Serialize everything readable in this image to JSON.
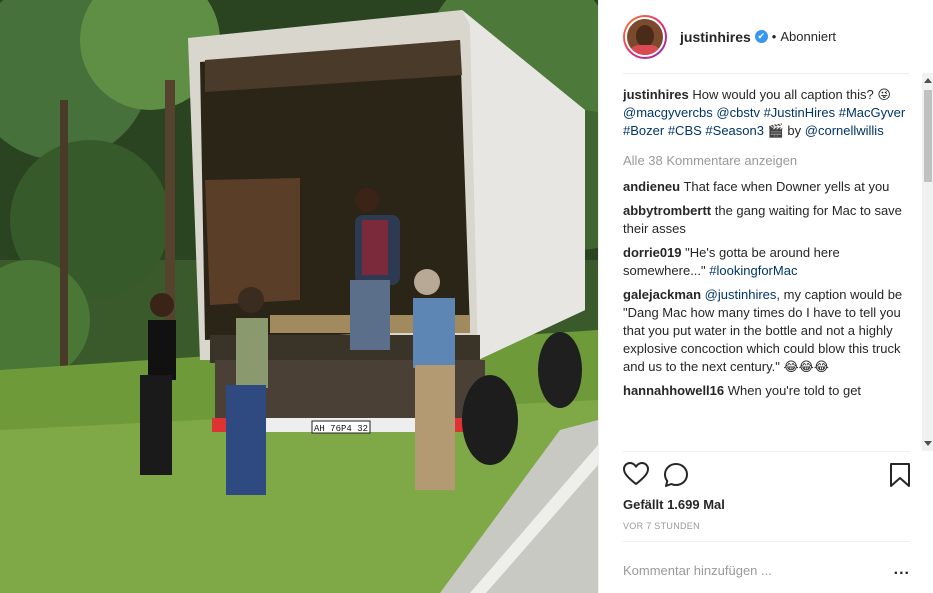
{
  "post": {
    "username": "justinhires",
    "verified_mark": "✔",
    "separator": "•",
    "follow_status": "Abonniert",
    "likes": "Gefällt 1.699 Mal",
    "timestamp": "VOR 7 STUNDEN",
    "add_comment_placeholder": "Kommentar hinzufügen ...",
    "more_options": "...",
    "license_plate": "AH 76P4 32"
  },
  "caption": {
    "user": "justinhires",
    "text_1": "How would you all caption this? 😜",
    "tag_1": "@macgyvercbs",
    "tag_2": "@cbstv",
    "tag_3": "#JustinHires",
    "tag_4": "#MacGyver",
    "tag_5": "#Bozer",
    "tag_6": "#CBS",
    "tag_7": "#Season3",
    "text_2": "🎬 by",
    "tag_8": "@cornellwillis"
  },
  "load_more": "Alle 38 Kommentare anzeigen",
  "comments": [
    {
      "user": "andieneu",
      "text": "That face when Downer yells at you"
    },
    {
      "user": "abbytrombertt",
      "text": "the gang waiting for Mac to save their asses"
    },
    {
      "user": "dorrie019",
      "text": "\"He's gotta be around here somewhere...\"",
      "tag": "#lookingforMac"
    },
    {
      "user": "galejackman",
      "tag": "@justinhires,",
      "text": "my caption would be \"Dang Mac how many times do I have to tell you that you put water in the bottle and not a highly explosive concoction which could blow this truck and us to the next century.\" 😂😂😂"
    },
    {
      "user": "hannahhowell16",
      "text": "When you're told to get"
    }
  ],
  "icons": {
    "like": "heart-icon",
    "comment": "comment-bubble-icon",
    "save": "bookmark-icon"
  },
  "colors": {
    "link": "#003569",
    "muted": "#999999",
    "verified": "#3897f0",
    "text": "#262626"
  }
}
